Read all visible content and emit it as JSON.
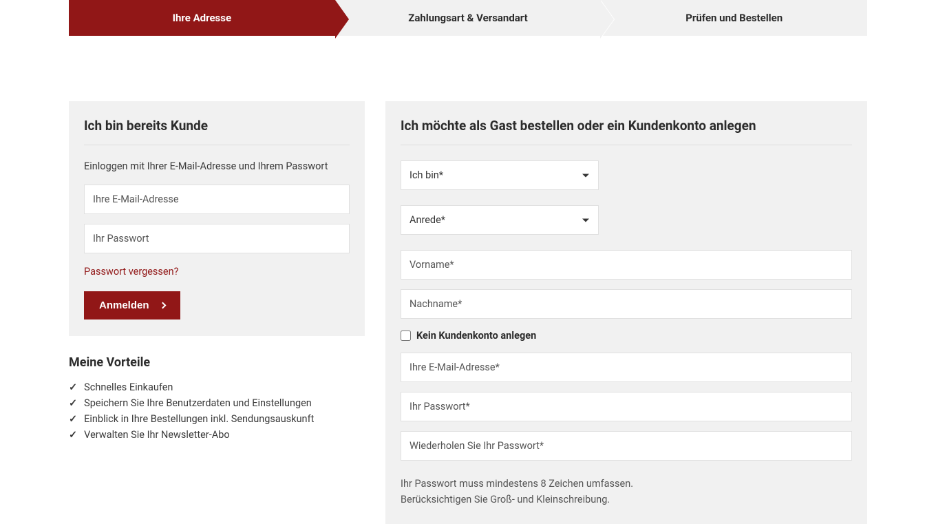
{
  "steps": [
    {
      "label": "Ihre Adresse"
    },
    {
      "label": "Zahlungsart & Versandart"
    },
    {
      "label": "Prüfen und Bestellen"
    }
  ],
  "login": {
    "heading": "Ich bin bereits Kunde",
    "subtext": "Einloggen mit Ihrer E-Mail-Adresse und Ihrem Passwort",
    "email_placeholder": "Ihre E-Mail-Adresse",
    "password_placeholder": "Ihr Passwort",
    "forgot_label": "Passwort vergessen?",
    "submit_label": "Anmelden"
  },
  "benefits": {
    "heading": "Meine Vorteile",
    "items": [
      "Schnelles Einkaufen",
      "Speichern Sie Ihre Benutzerdaten und Einstellungen",
      "Einblick in Ihre Bestellungen inkl. Sendungsauskunft",
      "Verwalten Sie Ihr Newsletter-Abo"
    ]
  },
  "register": {
    "heading": "Ich möchte als Gast bestellen oder ein Kundenkonto anlegen",
    "customer_type_label": "Ich bin*",
    "salutation_label": "Anrede*",
    "firstname_placeholder": "Vorname*",
    "lastname_placeholder": "Nachname*",
    "no_account_label": "Kein Kundenkonto anlegen",
    "email_placeholder": "Ihre E-Mail-Adresse*",
    "password_placeholder": "Ihr Passwort*",
    "password_confirm_placeholder": "Wiederholen Sie Ihr Passwort*",
    "password_hint_line1": "Ihr Passwort muss mindestens 8 Zeichen umfassen.",
    "password_hint_line2": "Berücksichtigen Sie Groß- und Kleinschreibung."
  }
}
